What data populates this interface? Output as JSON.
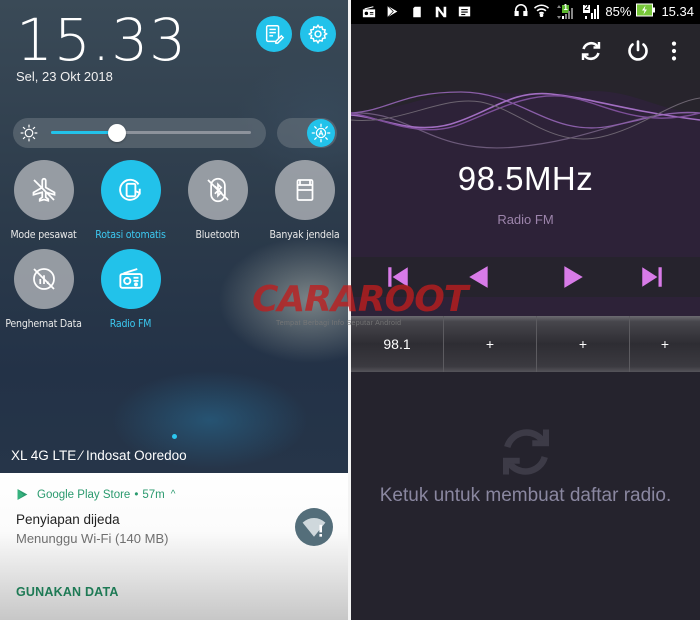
{
  "left_panel": {
    "clock": {
      "hour": "15",
      "minute": "33",
      "separator": "."
    },
    "date": "Sel, 23 Okt 2018",
    "top_buttons": [
      {
        "name": "edit-tiles",
        "icon": "edit-list-icon"
      },
      {
        "name": "settings",
        "icon": "gear-icon"
      }
    ],
    "brightness": {
      "level_percent": 33,
      "auto_icon": "auto-brightness-icon"
    },
    "tiles": [
      {
        "label": "Mode pesawat",
        "icon": "airplane-off-icon",
        "active": false
      },
      {
        "label": "Rotasi otomatis",
        "icon": "auto-rotate-icon",
        "active": true
      },
      {
        "label": "Bluetooth",
        "icon": "bluetooth-off-icon",
        "active": false
      },
      {
        "label": "Banyak jendela",
        "icon": "multi-window-icon",
        "active": false
      },
      {
        "label": "Penghemat Data",
        "icon": "data-saver-off-icon",
        "active": false
      },
      {
        "label": "Radio FM",
        "icon": "radio-icon",
        "active": true
      }
    ],
    "carrier": "XL 4G LTE ⁄ Indosat Ooredoo",
    "notification": {
      "app": "Google Play Store",
      "time": "57m",
      "separator": "•",
      "expand_glyph": "^",
      "title": "Penyiapan dijeda",
      "subtitle": "Menunggu Wi-Fi (140 MB)",
      "action": "GUNAKAN DATA",
      "accent": "#2a9a6e"
    }
  },
  "right_panel": {
    "status_bar": {
      "left_icons": [
        "radio-icon",
        "play-store-icon",
        "sd-card-icon",
        "n-icon",
        "message-icon"
      ],
      "right_icons": [
        "headphones-icon",
        "wifi-icon",
        "signal-sim1-icon",
        "signal-sim2-icon",
        "battery-charging-icon"
      ],
      "sim1_label": "1",
      "sim2_label": "2",
      "battery": "85%",
      "time": "15.34"
    },
    "app_bar": {
      "actions": [
        "refresh-icon",
        "power-icon",
        "more-vert-icon"
      ]
    },
    "frequency": "98.5MHz",
    "station_label": "Radio FM",
    "controls": [
      "skip-previous",
      "seek-back",
      "seek-forward",
      "skip-next"
    ],
    "accent": "#d87be8",
    "presets": [
      "98.1",
      "+",
      "+",
      "+"
    ],
    "empty_message": "Ketuk untuk membuat daftar radio."
  },
  "watermark": {
    "logo": "CARAROOT",
    "tagline": "Tempat Berbagi Info Seputar Android"
  }
}
